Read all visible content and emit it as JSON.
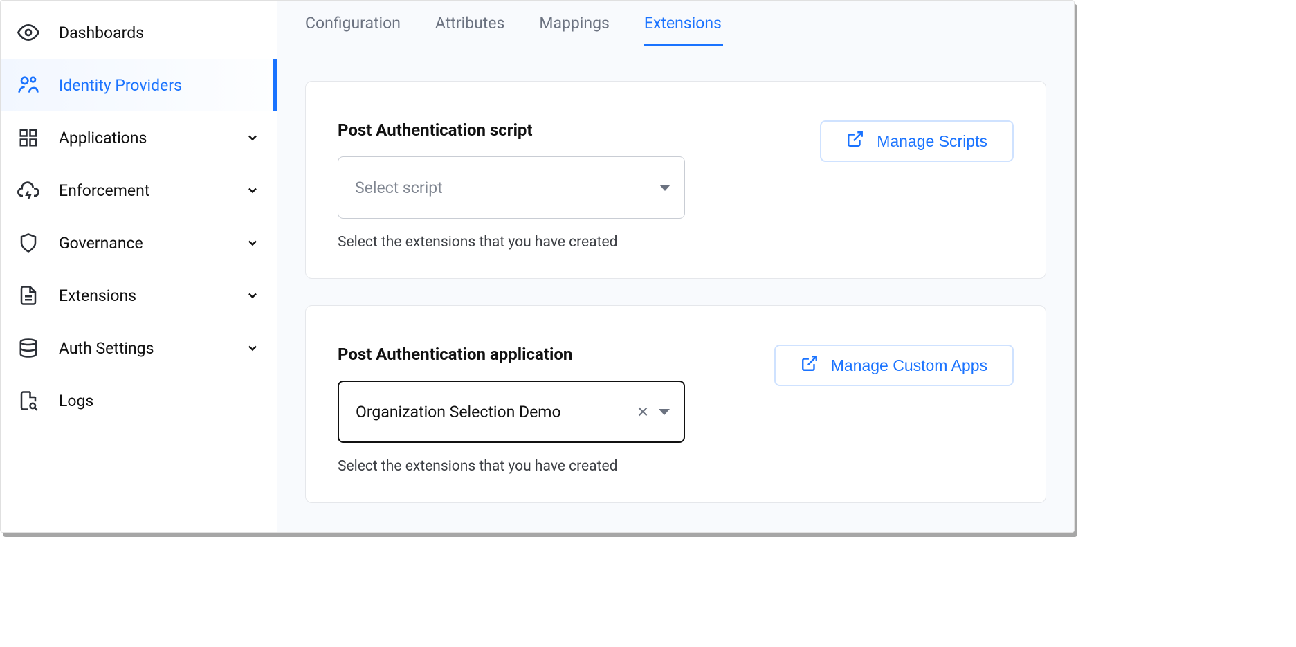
{
  "sidebar": {
    "items": [
      {
        "label": "Dashboards",
        "expandable": false
      },
      {
        "label": "Identity Providers",
        "expandable": false
      },
      {
        "label": "Applications",
        "expandable": true
      },
      {
        "label": "Enforcement",
        "expandable": true
      },
      {
        "label": "Governance",
        "expandable": true
      },
      {
        "label": "Extensions",
        "expandable": true
      },
      {
        "label": "Auth Settings",
        "expandable": true
      },
      {
        "label": "Logs",
        "expandable": false
      }
    ]
  },
  "tabs": [
    {
      "label": "Configuration"
    },
    {
      "label": "Attributes"
    },
    {
      "label": "Mappings"
    },
    {
      "label": "Extensions"
    }
  ],
  "cards": {
    "script": {
      "title": "Post Authentication script",
      "placeholder": "Select script",
      "help": "Select the extensions that you have created",
      "button": "Manage Scripts"
    },
    "app": {
      "title": "Post Authentication application",
      "value": "Organization Selection Demo",
      "help": "Select the extensions that you have created",
      "button": "Manage Custom Apps"
    }
  }
}
